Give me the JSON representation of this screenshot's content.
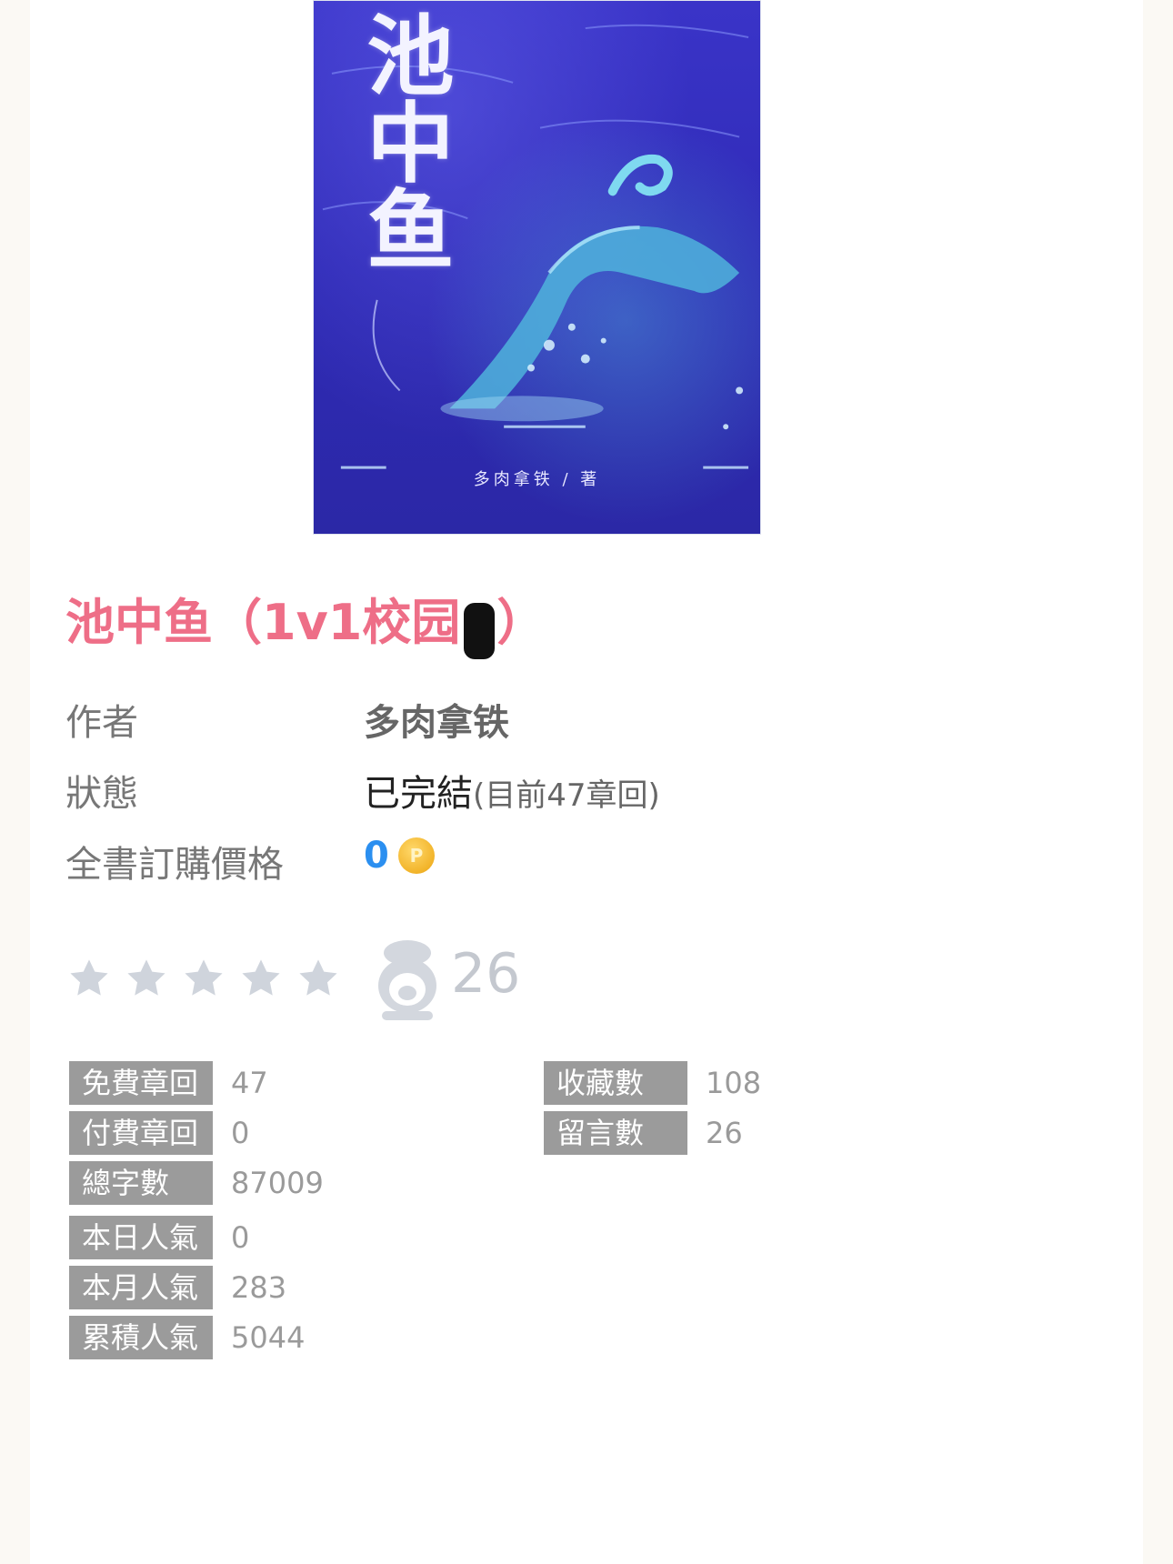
{
  "cover": {
    "title_text": "池中鱼",
    "author_text": "多肉拿铁 / 著"
  },
  "book": {
    "title": "池中鱼（1v1校园",
    "title_end": "）"
  },
  "info": {
    "author_label": "作者",
    "author_value": "多肉拿铁",
    "status_label": "狀態",
    "status_value": "已完結",
    "status_detail": "(目前47章回)",
    "price_label": "全書訂購價格",
    "price_value": "0",
    "coin_symbol": "P"
  },
  "rating": {
    "stars_filled": 0,
    "stars_total": 5,
    "comment_count": "26",
    "star_color": "#cfd4dc",
    "icon": "comment-mascot-icon"
  },
  "stats": {
    "free_chapters_label": "免費章回",
    "free_chapters_value": "47",
    "paid_chapters_label": "付費章回",
    "paid_chapters_value": "0",
    "total_words_label": "總字數",
    "total_words_value": "87009",
    "favorites_label": "收藏數",
    "favorites_value": "108",
    "comments_label": "留言數",
    "comments_value": "26",
    "daily_pop_label": "本日人氣",
    "daily_pop_value": "0",
    "monthly_pop_label": "本月人氣",
    "monthly_pop_value": "283",
    "total_pop_label": "累積人氣",
    "total_pop_value": "5044"
  },
  "colors": {
    "title": "#ee6e87",
    "price": "#2b8ff0",
    "stat_label_bg": "#9b9b9b",
    "cover_bg": "#3a34c8"
  }
}
